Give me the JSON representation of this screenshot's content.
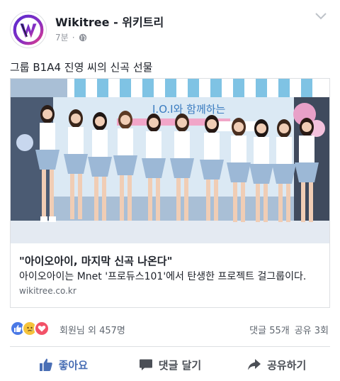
{
  "post": {
    "page_name": "Wikitree - 위키트리",
    "time": "7분",
    "dot": "·",
    "text": "그룹 B1A4 진영 씨의 신곡 선물",
    "icons": {
      "avatar": "wikitree-logo",
      "audience": "globe-icon",
      "menu": "chevron-down-icon"
    }
  },
  "link_card": {
    "image_label": "I.O.I와 함께하는",
    "title": "\"아이오아이, 마지막 신곡 나온다\"",
    "description": "아이오아이는 Mnet '프로듀스101'에서 탄생한 프로젝트 걸그룹이다.",
    "domain": "wikitree.co.kr"
  },
  "reactions": {
    "icons": [
      "like-icon",
      "sad-icon",
      "love-icon"
    ],
    "summary": "회원님 외 457명",
    "comments": "댓글 55개",
    "shares": "공유 3회"
  },
  "actions": {
    "like": "좋아요",
    "comment": "댓글 달기",
    "share": "공유하기"
  },
  "colors": {
    "brand_blue": "#4a6fb5",
    "like_blue": "#4a79e6",
    "sad_yellow": "#f5c33b",
    "love_red": "#f25268",
    "logo_purple": "#6b2fc4",
    "logo_pink": "#e23c8a"
  }
}
